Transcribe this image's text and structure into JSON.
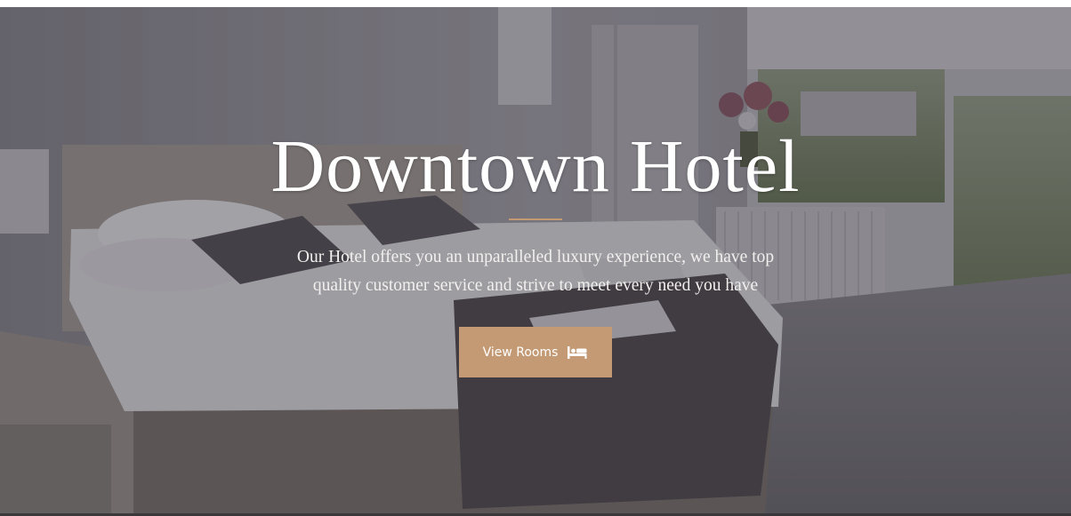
{
  "hero": {
    "title": "Downtown Hotel",
    "description": "Our Hotel offers you an unparalleled luxury experience, we have top quality customer service and strive to meet every need you have",
    "button": {
      "label": "View Rooms",
      "icon": "bed-icon"
    }
  },
  "colors": {
    "accent": "#c49a74",
    "overlay": "#28262c",
    "text": "#ffffff"
  }
}
